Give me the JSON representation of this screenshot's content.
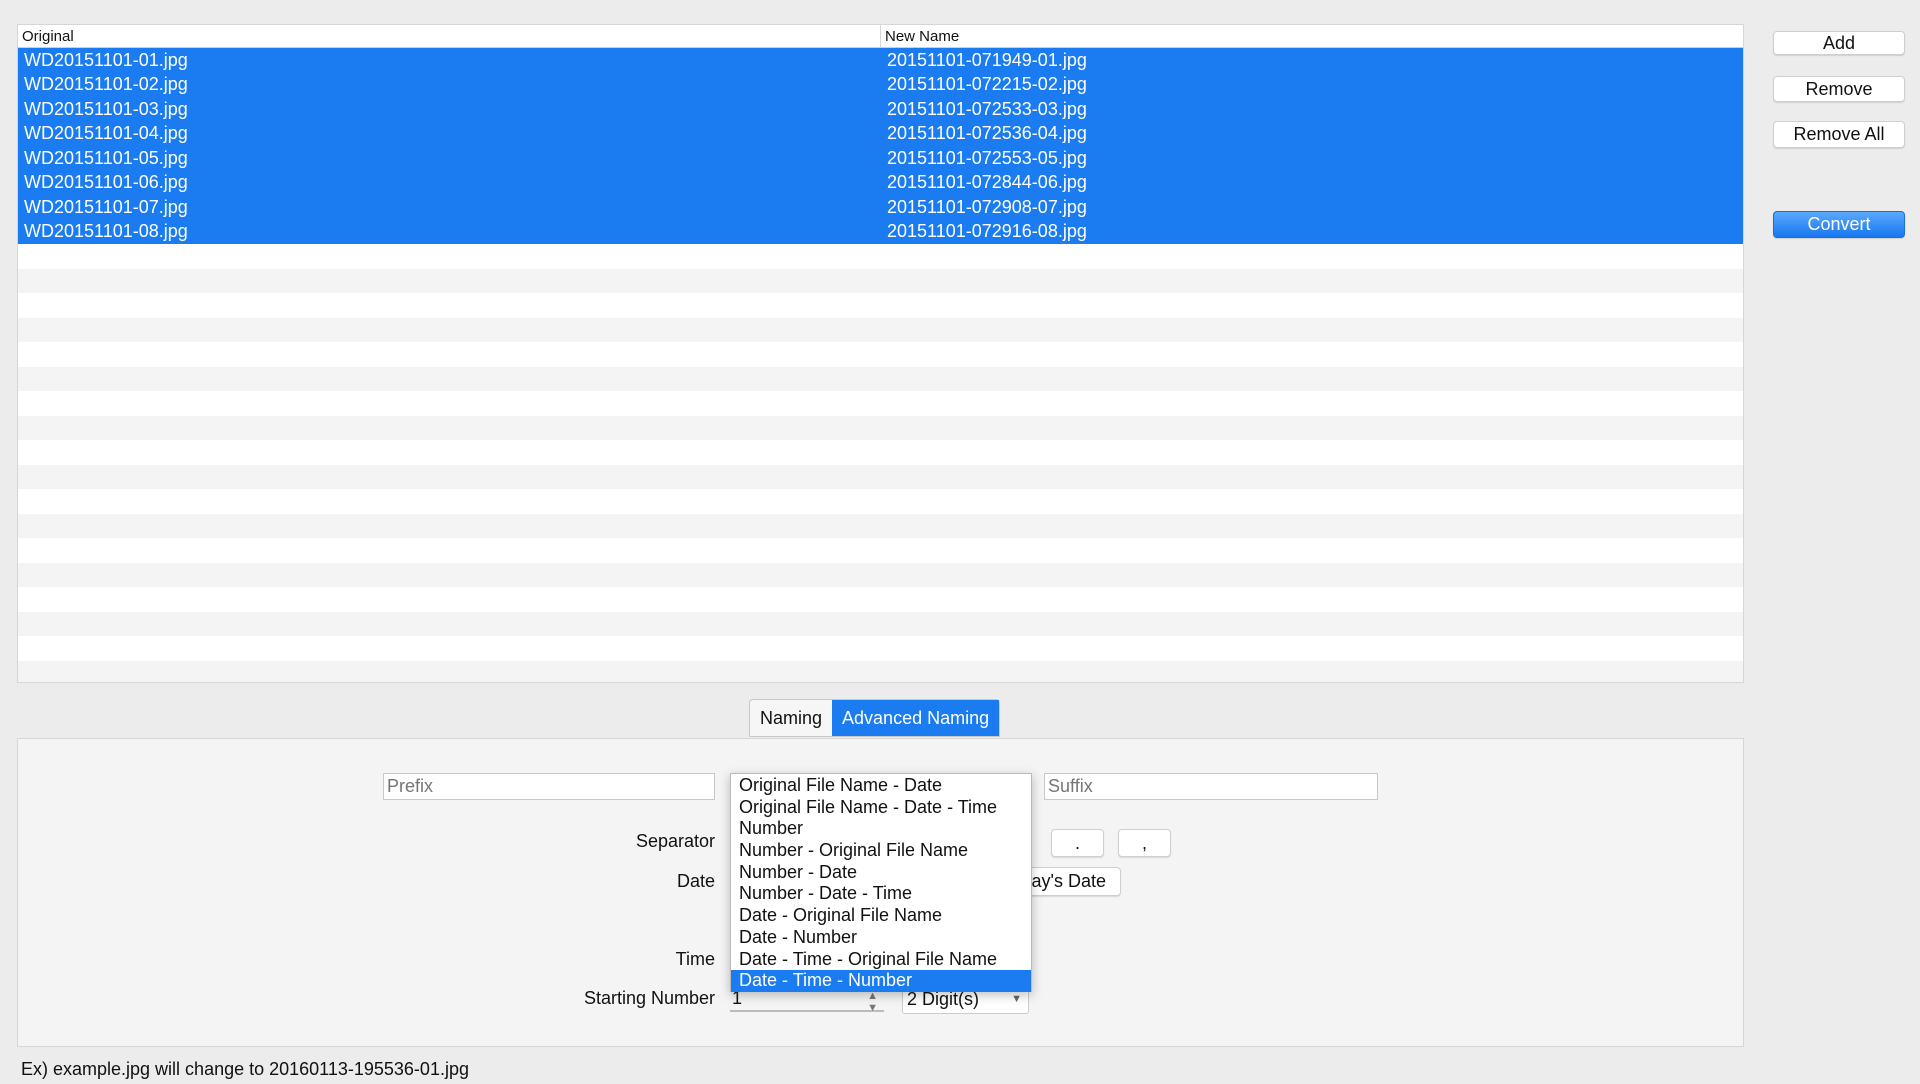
{
  "table": {
    "headers": [
      "Original",
      "New Name"
    ],
    "rows": [
      [
        "WD20151101-01.jpg",
        "20151101-071949-01.jpg"
      ],
      [
        "WD20151101-02.jpg",
        "20151101-072215-02.jpg"
      ],
      [
        "WD20151101-03.jpg",
        "20151101-072533-03.jpg"
      ],
      [
        "WD20151101-04.jpg",
        "20151101-072536-04.jpg"
      ],
      [
        "WD20151101-05.jpg",
        "20151101-072553-05.jpg"
      ],
      [
        "WD20151101-06.jpg",
        "20151101-072844-06.jpg"
      ],
      [
        "WD20151101-07.jpg",
        "20151101-072908-07.jpg"
      ],
      [
        "WD20151101-08.jpg",
        "20151101-072916-08.jpg"
      ]
    ]
  },
  "buttons": {
    "add": "Add",
    "remove": "Remove",
    "remove_all": "Remove All",
    "convert": "Convert"
  },
  "tabs": [
    {
      "label": "Naming",
      "active": false
    },
    {
      "label": "Advanced Naming",
      "active": true
    }
  ],
  "form": {
    "prefix_placeholder": "Prefix",
    "suffix_placeholder": "Suffix",
    "separator_label": "Separator",
    "sep_dot": ".",
    "sep_comma": ",",
    "date_label": "Date",
    "todays_date": "Today's Date",
    "time_label": "Time",
    "starting_number_label": "Starting Number",
    "starting_number": "1",
    "digits": "2 Digit(s)"
  },
  "format_options": [
    "Original File Name - Date",
    "Original File Name - Date - Time",
    "Number",
    "Number - Original File Name",
    "Number - Date",
    "Number - Date - Time",
    "Date - Original File Name",
    "Date - Number",
    "Date - Time - Original File Name",
    "Date - Time - Number"
  ],
  "format_selected": "Date - Time - Number",
  "example": "Ex) example.jpg will change to 20160113-195536-01.jpg",
  "colors": {
    "accent": "#1a7cf0"
  }
}
